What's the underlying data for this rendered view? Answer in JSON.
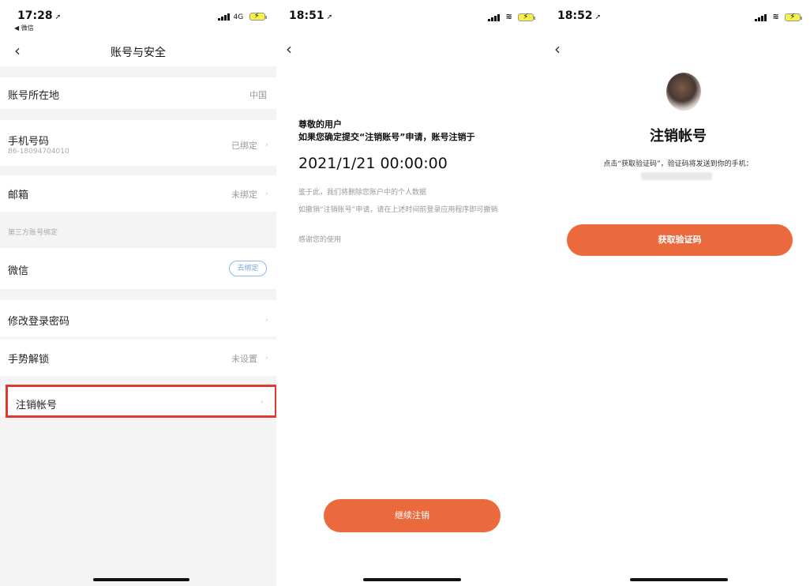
{
  "screen1": {
    "status": {
      "time": "17:28",
      "back_app": "◀ 微信",
      "network": "4G"
    },
    "title": "账号与安全",
    "rows": {
      "location_label": "账号所在地",
      "location_value": "中国",
      "phone_label": "手机号码",
      "phone_sub": "86-18094704010",
      "phone_value": "已绑定",
      "email_label": "邮箱",
      "email_value": "未绑定",
      "third_party_section": "第三方账号绑定",
      "wechat_label": "微信",
      "wechat_action": "去绑定",
      "password_label": "修改登录密码",
      "gesture_label": "手势解锁",
      "gesture_value": "未设置",
      "cancel_label": "注销帐号"
    }
  },
  "screen2": {
    "status": {
      "time": "18:51"
    },
    "greeting_line1": "尊敬的用户",
    "greeting_line2": "如果您确定提交“注销账号”申请，账号注销于",
    "date": "2021/1/21 00:00:00",
    "para1": "鉴于此，我们将删除您账户中的个人数据",
    "para2": "如撤销“注销账号”申请，请在上述时间前登录应用程序即可撤销",
    "para3": "感谢您的使用",
    "continue_button": "继续注销"
  },
  "screen3": {
    "status": {
      "time": "18:52"
    },
    "title": "注销帐号",
    "description": "点击“获取验证码”，验证码将发送到你的手机：",
    "get_code_button": "获取验证码"
  },
  "colors": {
    "accent": "#ea6a3e",
    "highlight": "#e03a2f",
    "link": "#7aa6da"
  }
}
